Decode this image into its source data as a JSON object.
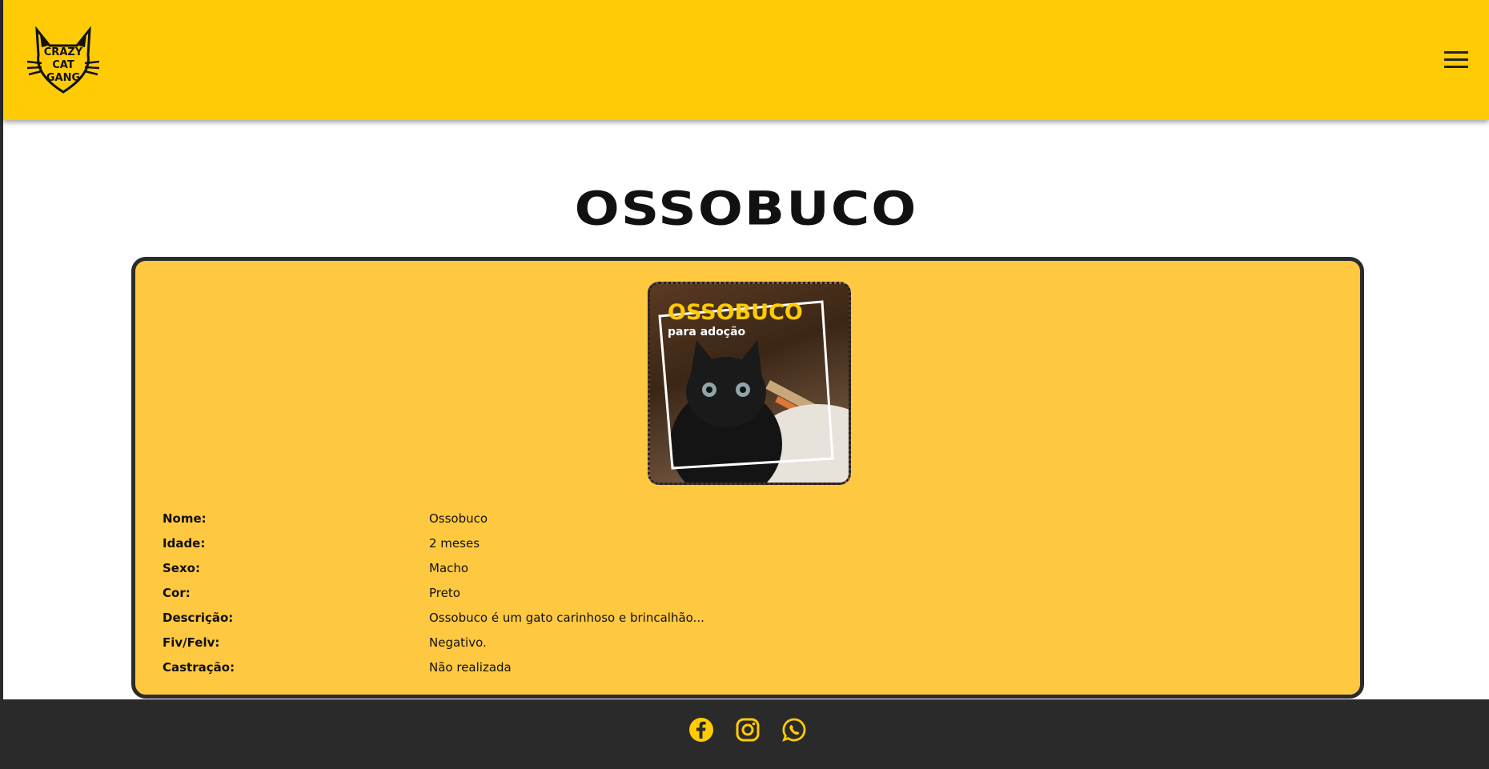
{
  "colors": {
    "header": "#ffcb05",
    "card": "#ffc841",
    "footer": "#2a2a2a",
    "accent": "#ffcb05"
  },
  "header": {
    "logo_icon": "crazy-cat-gang-logo",
    "menu_icon": "hamburger-menu-icon"
  },
  "pet": {
    "name_title": "OSSOBUCO",
    "photo": {
      "overlay_title": "OSSOBUCO",
      "overlay_subtitle": "para adoção"
    },
    "details": [
      {
        "label": "Nome:",
        "value": "Ossobuco"
      },
      {
        "label": "Idade:",
        "value": "2 meses"
      },
      {
        "label": "Sexo:",
        "value": "Macho"
      },
      {
        "label": "Cor:",
        "value": "Preto"
      },
      {
        "label": "Descrição:",
        "value": "Ossobuco é um gato carinhoso e brincalhão..."
      },
      {
        "label": "Fiv/Felv:",
        "value": "Negativo."
      },
      {
        "label": "Castração:",
        "value": "Não realizada"
      }
    ]
  },
  "footer": {
    "icons": [
      "facebook-icon",
      "instagram-icon",
      "whatsapp-icon"
    ]
  }
}
